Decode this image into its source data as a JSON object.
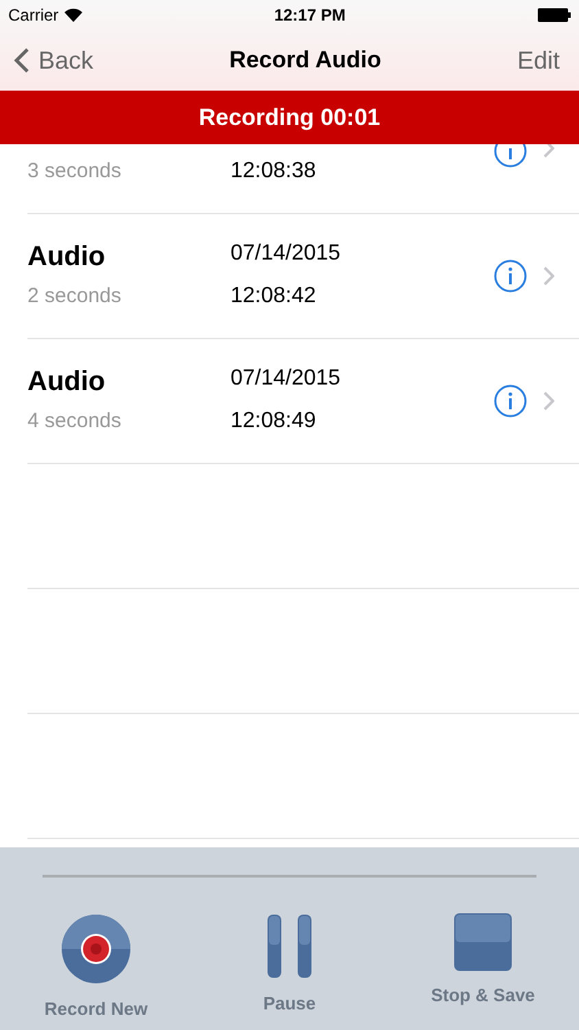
{
  "status_bar": {
    "carrier": "Carrier",
    "time": "12:17 PM"
  },
  "nav": {
    "back": "Back",
    "title": "Record Audio",
    "edit": "Edit"
  },
  "banner": "Recording 00:01",
  "recordings": [
    {
      "kind": "cut",
      "duration": "3 seconds",
      "time": "12:08:38"
    },
    {
      "kind": "full",
      "title": "Audio",
      "duration": "2 seconds",
      "date": "07/14/2015",
      "time": "12:08:42"
    },
    {
      "kind": "full",
      "title": "Audio",
      "duration": "4 seconds",
      "date": "07/14/2015",
      "time": "12:08:49"
    }
  ],
  "toolbar": [
    {
      "kind": "record",
      "label": "Record New"
    },
    {
      "kind": "pause",
      "label": "Pause"
    },
    {
      "kind": "stop",
      "label": "Stop & Save"
    }
  ]
}
